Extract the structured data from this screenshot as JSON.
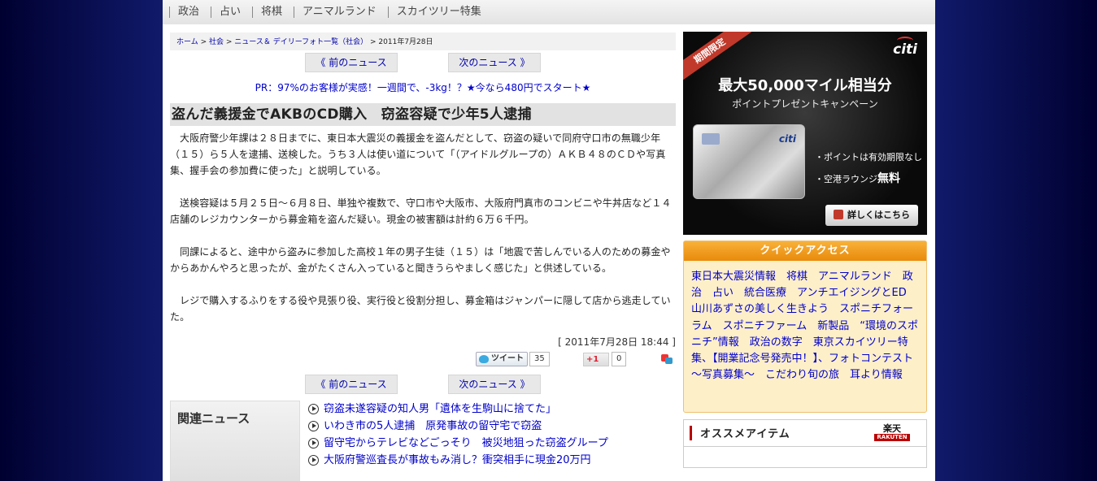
{
  "topnav": [
    "政治",
    "占い",
    "将棋",
    "アニマルランド",
    "スカイツリー特集"
  ],
  "breadcrumb": {
    "home": "ホーム",
    "sep1": " > ",
    "society": "社会",
    "sep2": " > ",
    "daily": "ニュース＆ デイリーフォト一覧（社会）",
    "sep3": " > ",
    "date": "2011年7月28日"
  },
  "nav": {
    "prev": "《 前のニュース",
    "next": "次のニュース 》"
  },
  "pr": "PR：97%のお客様が実感！一週間で、-3kg！？★今なら480円でスタート★",
  "article": {
    "headline": "盗んだ義援金でAKBのCD購入　窃盗容疑で少年5人逮捕",
    "paragraphs": [
      "大阪府警少年課は２８日までに、東日本大震災の義援金を盗んだとして、窃盗の疑いで同府守口市の無職少年（１５）ら５人を逮捕、送検した。うち３人は使い道について「（アイドルグループの）ＡＫＢ４８のＣＤや写真集、握手会の参加費に使った」と説明している。",
      "送検容疑は５月２５日～６月８日、単独や複数で、守口市や大阪市、大阪府門真市のコンビニや牛丼店など１４店舗のレジカウンターから募金箱を盗んだ疑い。現金の被害額は計約６万６千円。",
      "同課によると、途中から盗みに参加した高校１年の男子生徒（１５）は「地震で苦しんでいる人のための募金やからあかんやろと思ったが、金がたくさん入っていると聞きうらやましく感じた」と供述している。",
      "レジで購入するふりをする役や見張り役、実行役と役割分担し、募金箱はジャンパーに隠して店から逃走していた。"
    ],
    "dateline": "[ 2011年7月28日 18:44 ]"
  },
  "social": {
    "tweet": "ツイート",
    "tweet_count": "35",
    "gplus": "+1",
    "gplus_count": "0"
  },
  "related": {
    "title": "関連ニュース",
    "items": [
      "窃盗未遂容疑の知人男「遺体を生駒山に捨てた」",
      "いわき市の5人逮捕　原発事故の留守宅で窃盗",
      "留守宅からテレビなどごっそり　被災地狙った窃盗グループ",
      "大阪府警巡査長が事故もみ消し？衝突相手に現金20万円"
    ]
  },
  "ad": {
    "ribbon": "期間限定",
    "brand": "citi",
    "headline": "最大50,000マイル相当分",
    "sub": "ポイントプレゼントキャンペーン",
    "card_brand": "citi",
    "bullet1": "・ポイントは有効期限なし",
    "bullet2_prefix": "・空港ラウンジ",
    "bullet2_bold": "無料",
    "more": "詳しくはこちら"
  },
  "quick": {
    "title": "クイックアクセス",
    "text": "東日本大震災情報　将棋　アニマルランド　政治　占い　統合医療　アンチエイジングとED　山川あずさの美しく生きよう　スポニチフォーラム　スポニチファーム　新製品　“環境のスポニチ”情報　政治の数字　東京スカイツリー特集、【開業記念号発売中！】、フォトコンテスト～写真募集～　こだわり旬の旅　耳より情報"
  },
  "osusume": {
    "title": "オススメアイテム",
    "rakuten": "楽天",
    "rakuten_sub": "RAKUTEN"
  }
}
